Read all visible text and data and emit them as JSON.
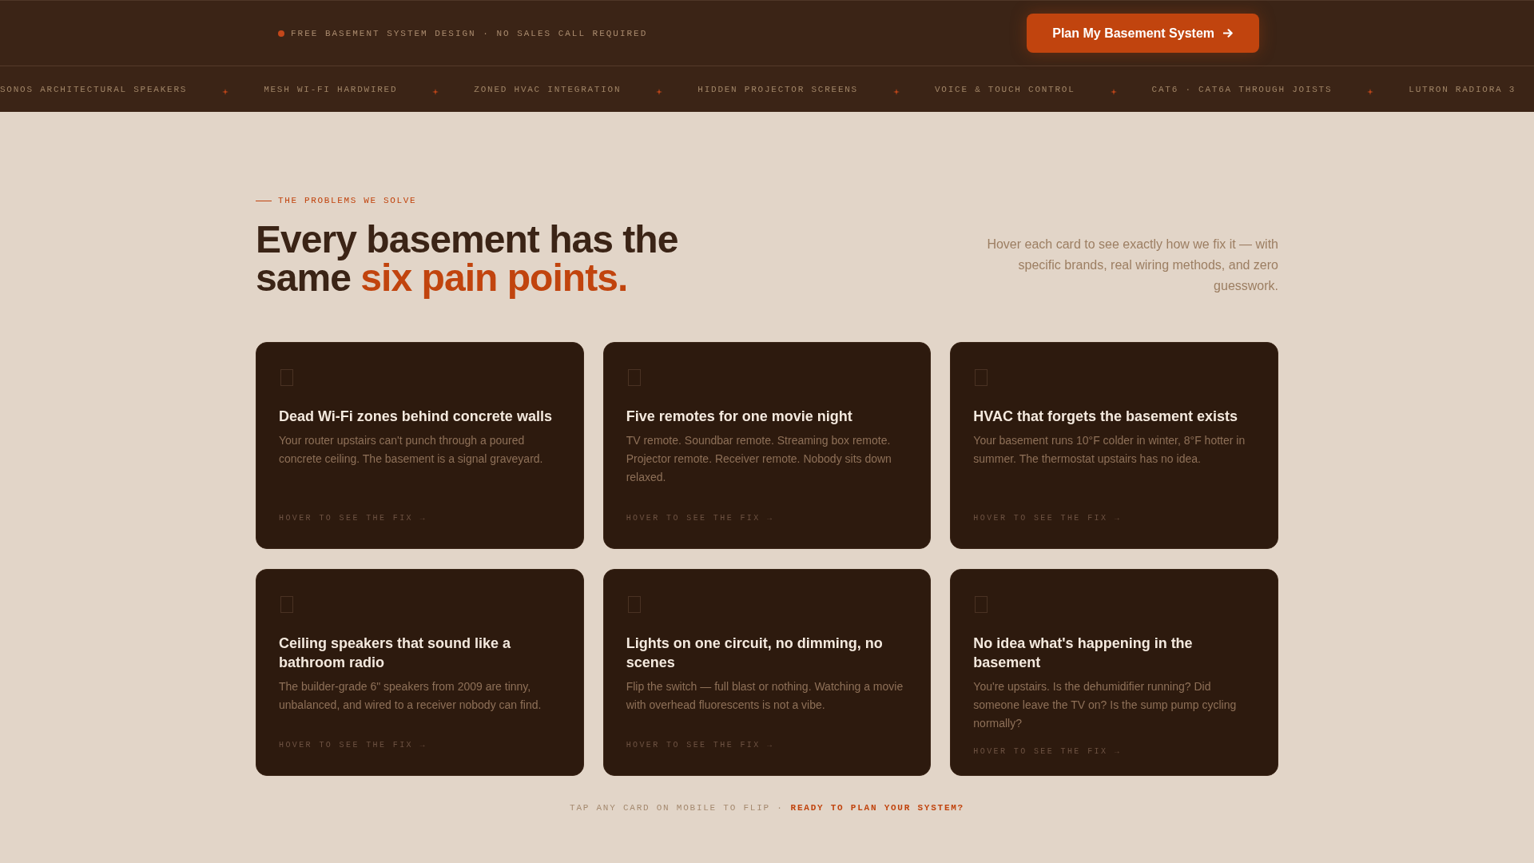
{
  "announcement_bar": {
    "text": "FREE BASEMENT SYSTEM DESIGN · NO SALES CALL REQUIRED",
    "button": {
      "label": "Plan My Basement System"
    }
  },
  "ticker": {
    "items": [
      "SONOS ARCHITECTURAL SPEAKERS",
      "MESH WI-FI HARDWIRED",
      "ZONED HVAC INTEGRATION",
      "HIDDEN PROJECTOR SCREENS",
      "VOICE & TOUCH CONTROL",
      "CAT6 · CAT6A THROUGH JOISTS",
      "LUTRON RADIORA 3"
    ]
  },
  "problems_section": {
    "eyebrow": "THE PROBLEMS WE SOLVE",
    "heading": {
      "text": "Every basement has the same",
      "highlight": "six pain points."
    },
    "intro": "Hover each card to see exactly how we fix it — with specific brands, real wiring methods, and zero guesswork.",
    "cards": [
      {
        "title": "Dead Wi-Fi zones behind concrete walls",
        "description": "Your router upstairs can't punch through a poured concrete ceiling. The basement is a signal graveyard.",
        "hint": "HOVER TO SEE THE FIX →"
      },
      {
        "title": "Five remotes for one movie night",
        "description": "TV remote. Soundbar remote. Streaming box remote. Projector remote. Receiver remote. Nobody sits down relaxed.",
        "hint": "HOVER TO SEE THE FIX →"
      },
      {
        "title": "HVAC that forgets the basement exists",
        "description": "Your basement runs 10°F colder in winter, 8°F hotter in summer. The thermostat upstairs has no idea.",
        "hint": "HOVER TO SEE THE FIX →"
      },
      {
        "title": "Ceiling speakers that sound like a bathroom radio",
        "description": "The builder-grade 6\" speakers from 2009 are tinny, unbalanced, and wired to a receiver nobody can find.",
        "hint": "HOVER TO SEE THE FIX →"
      },
      {
        "title": "Lights on one circuit, no dimming, no scenes",
        "description": "Flip the switch — full blast or nothing. Watching a movie with overhead fluorescents is not a vibe.",
        "hint": "HOVER TO SEE THE FIX →"
      },
      {
        "title": "No idea what's happening in the basement",
        "description": "You're upstairs. Is the dehumidifier running? Did someone leave the TV on? Is the sump pump cycling normally?",
        "hint": "HOVER TO SEE THE FIX →"
      }
    ]
  },
  "footer_note": {
    "text": "TAP ANY CARD ON MOBILE TO FLIP ·",
    "link": "READY TO PLAN YOUR SYSTEM?"
  }
}
